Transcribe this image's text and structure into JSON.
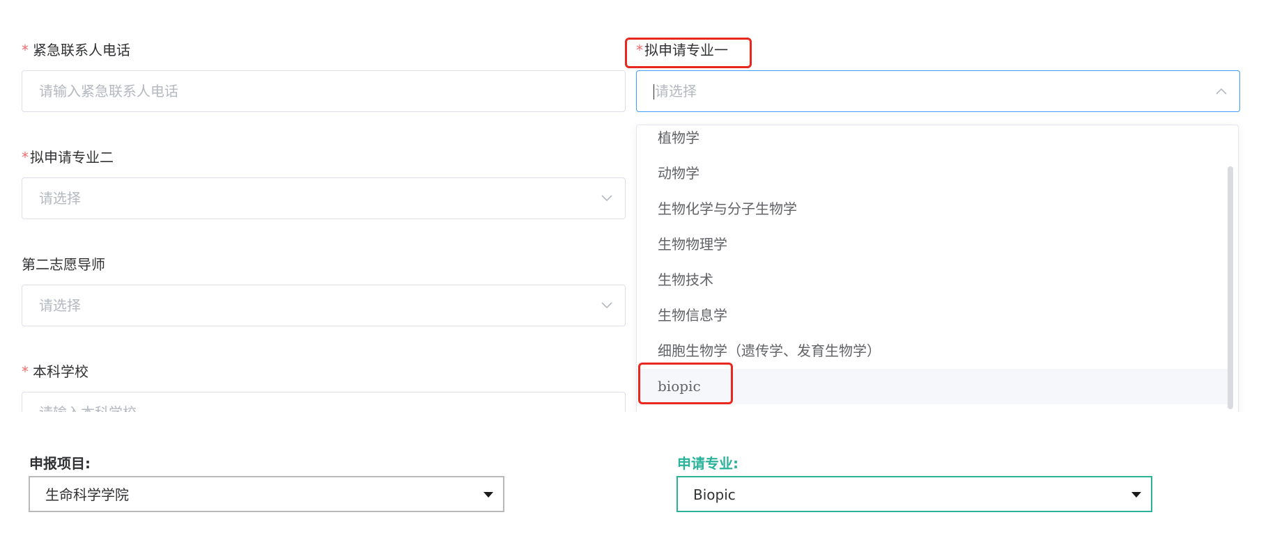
{
  "form": {
    "emergency_phone": {
      "label": "紧急联系人电话",
      "placeholder": "请输入紧急联系人电话"
    },
    "major_one": {
      "label": "拟申请专业一",
      "placeholder": "请选择",
      "options": [
        "植物学",
        "动物学",
        "生物化学与分子生物学",
        "生物物理学",
        "生物技术",
        "生物信息学",
        "细胞生物学（遗传学、发育生物学）",
        "biopic"
      ],
      "hovered_option": "biopic"
    },
    "major_two": {
      "label": "拟申请专业二",
      "placeholder": "请选择"
    },
    "second_advisor": {
      "label": "第二志愿导师",
      "placeholder": "请选择"
    },
    "undergrad_school": {
      "label": "本科学校",
      "placeholder": "请输入本科学校"
    },
    "required_mark": "*"
  },
  "bottom_form": {
    "project": {
      "label": "申报项目:",
      "value": "生命科学学院"
    },
    "major": {
      "label": "申请专业:",
      "value": "Biopic"
    }
  },
  "colors": {
    "required": "#f56c6c",
    "focus_border": "#409eff",
    "highlight_box": "#e8281e",
    "teal": "#2bb39a"
  }
}
